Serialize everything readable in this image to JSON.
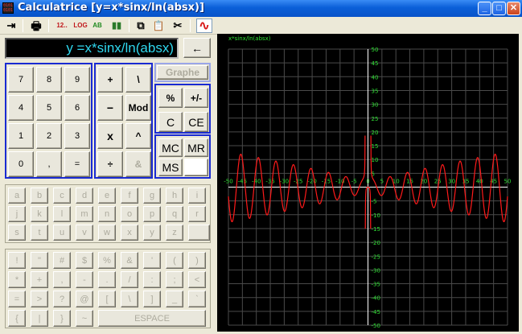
{
  "window": {
    "title": "Calculatrice [y=x*sinx/ln(absx)]",
    "icon_text": "0101 0101",
    "minimize_glyph": "_",
    "maximize_glyph": "□",
    "close_glyph": "✕"
  },
  "toolbar": {
    "items": [
      {
        "name": "exit-door-icon",
        "label": "⇥"
      },
      {
        "name": "printer-icon",
        "label": "🖶"
      },
      {
        "name": "decimal-format-button",
        "label": "12.."
      },
      {
        "name": "log-button",
        "label": "LOG"
      },
      {
        "name": "ab-button",
        "label": "AB"
      },
      {
        "name": "bar-chart-icon",
        "label": "▮▮"
      },
      {
        "name": "copy-icon",
        "label": "⧉"
      },
      {
        "name": "paste-icon",
        "label": "📋"
      },
      {
        "name": "cut-icon",
        "label": "✂"
      },
      {
        "name": "graph-curve-icon",
        "label": "∿"
      }
    ],
    "colors": {
      "decimal": "#c0181c",
      "log": "#c0181c",
      "ab": "#208a20",
      "curve": "#d81818"
    }
  },
  "display": {
    "value": "y =x*sinx/ln(absx)",
    "backspace_label": "←"
  },
  "numpad": {
    "keys": [
      "7",
      "8",
      "9",
      "4",
      "5",
      "6",
      "1",
      "2",
      "3",
      "0",
      ",",
      "="
    ]
  },
  "operators": {
    "keys": [
      "+",
      "\\",
      "−",
      "Mod",
      "x",
      "^",
      "÷",
      "&"
    ]
  },
  "functions": {
    "graphe": "Graphe",
    "percent": "%",
    "plusminus": "+/-",
    "c": "C",
    "ce": "CE",
    "mc": "MC",
    "mr": "MR",
    "ms": "MS",
    "memory_value": ""
  },
  "keyboard": {
    "letters": [
      "a",
      "b",
      "c",
      "d",
      "e",
      "f",
      "g",
      "h",
      "i",
      "j",
      "k",
      "l",
      "m",
      "n",
      "o",
      "p",
      "q",
      "r",
      "s",
      "t",
      "u",
      "v",
      "w",
      "x",
      "y",
      "z",
      ""
    ],
    "symbols": [
      "!",
      "\"",
      "#",
      "$",
      "%",
      "&",
      "'",
      "(",
      ")",
      "*",
      "+",
      ",",
      "-",
      ".",
      "/",
      ":",
      ";",
      "<",
      "=",
      ">",
      "?",
      "@",
      "[",
      "\\",
      "]",
      "_",
      "`",
      "{",
      "|",
      "}",
      "~"
    ],
    "space_label": "ESPACE"
  },
  "graph": {
    "label": "x*sinx/ln(absx)",
    "x_ticks": [
      "-50",
      "-45",
      "-40",
      "-35",
      "-30",
      "-25",
      "-20",
      "-15",
      "-10",
      "-5",
      "0",
      "5",
      "10",
      "15",
      "20",
      "25",
      "30",
      "35",
      "40",
      "45",
      "50"
    ],
    "y_ticks": [
      "50",
      "45",
      "40",
      "35",
      "30",
      "25",
      "20",
      "15",
      "10",
      "5",
      "0",
      "-5",
      "-10",
      "-15",
      "-20",
      "-25",
      "-30",
      "-35",
      "-40",
      "-45",
      "-50"
    ],
    "background_color": "#000000",
    "grid_color": "#4a4a4a",
    "axis_color": "#ffffff",
    "label_color": "#2fe234",
    "curve_color": "#ff1a1a",
    "function": "x*sin(x)/ln(abs(x))",
    "x_range": [
      -50,
      50
    ],
    "y_range": [
      -50,
      50
    ]
  }
}
